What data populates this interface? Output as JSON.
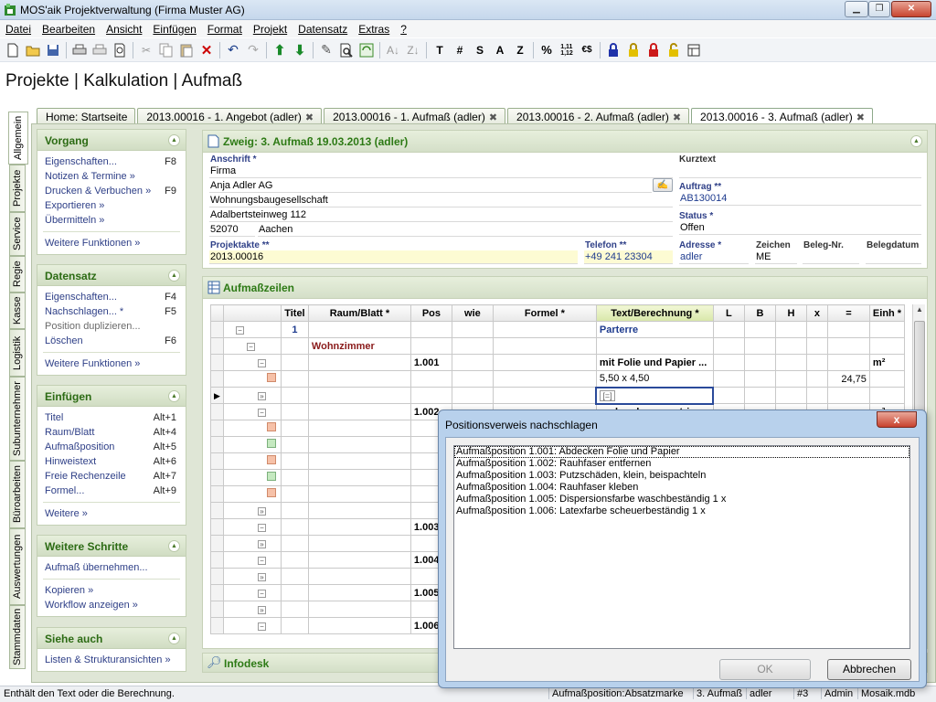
{
  "window": {
    "title": "MOS'aik Projektverwaltung (Firma Muster AG)"
  },
  "menu": [
    "Datei",
    "Bearbeiten",
    "Ansicht",
    "Einfügen",
    "Format",
    "Projekt",
    "Datensatz",
    "Extras",
    "?"
  ],
  "toolbar": {
    "text_buttons": [
      "T",
      "#",
      "S",
      "A",
      "Z",
      "%",
      "1,11\n1,12",
      "€$"
    ]
  },
  "heading": "Projekte | Kalkulation | Aufmaß",
  "tabs": [
    {
      "label": "Home: Startseite",
      "closable": false
    },
    {
      "label": "2013.00016 - 1. Angebot (adler)",
      "closable": true
    },
    {
      "label": "2013.00016 - 1. Aufmaß (adler)",
      "closable": true
    },
    {
      "label": "2013.00016 - 2. Aufmaß (adler)",
      "closable": true
    },
    {
      "label": "2013.00016 - 3. Aufmaß (adler)",
      "closable": true,
      "active": true
    }
  ],
  "vertical_tabs": [
    "Allgemein",
    "Projekte",
    "Service",
    "Regie",
    "Kasse",
    "Logistik",
    "Subunternehmer",
    "Büroarbeiten",
    "Auswertungen",
    "Stammdaten"
  ],
  "left_panel": {
    "vorgang": {
      "title": "Vorgang",
      "items": [
        {
          "label": "Eigenschaften...",
          "key": "F8"
        },
        {
          "label": "Notizen & Termine »",
          "key": ""
        },
        {
          "label": "Drucken & Verbuchen »",
          "key": "F9"
        },
        {
          "label": "Exportieren »",
          "key": ""
        },
        {
          "label": "Übermitteln »",
          "key": ""
        }
      ],
      "more": "Weitere Funktionen »"
    },
    "datensatz": {
      "title": "Datensatz",
      "items": [
        {
          "label": "Eigenschaften...",
          "key": "F4"
        },
        {
          "label": "Nachschlagen... *",
          "key": "F5"
        },
        {
          "label": "Position duplizieren...",
          "key": "",
          "disabled": true
        },
        {
          "label": "Löschen",
          "key": "F6"
        }
      ],
      "more": "Weitere Funktionen »"
    },
    "einfuegen": {
      "title": "Einfügen",
      "items": [
        {
          "label": "Titel",
          "key": "Alt+1"
        },
        {
          "label": "Raum/Blatt",
          "key": "Alt+4"
        },
        {
          "label": "Aufmaßposition",
          "key": "Alt+5"
        },
        {
          "label": "Hinweistext",
          "key": "Alt+6"
        },
        {
          "label": "Freie Rechenzeile",
          "key": "Alt+7"
        },
        {
          "label": "Formel...",
          "key": "Alt+9"
        }
      ],
      "more": "Weitere »"
    },
    "weitere_schritte": {
      "title": "Weitere Schritte",
      "items": [
        "Aufmaß übernehmen...",
        "Kopieren »",
        "Workflow anzeigen »"
      ]
    },
    "siehe_auch": {
      "title": "Siehe auch",
      "items": [
        "Listen & Strukturansichten »"
      ]
    }
  },
  "zweig": {
    "title": "Zweig: 3. Aufmaß 19.03.2013 (adler)",
    "anschrift_label": "Anschrift *",
    "anschrift": [
      "Firma",
      "Anja Adler AG",
      "Wohnungsbaugesellschaft",
      "Adalbertsteinweg 112"
    ],
    "plz": "52070",
    "ort": "Aachen",
    "kurztext_label": "Kurztext",
    "kurztext": "",
    "auftrag_label": "Auftrag **",
    "auftrag": "AB130014",
    "status_label": "Status *",
    "status": "Offen",
    "projektakte_label": "Projektakte **",
    "projektakte": "2013.00016",
    "telefon_label": "Telefon **",
    "telefon": "+49 241 23304",
    "adresse_label": "Adresse *",
    "adresse": "adler",
    "zeichen_label": "Zeichen",
    "zeichen": "ME",
    "belegnr_label": "Beleg-Nr.",
    "belegnr": "",
    "belegdatum_label": "Belegdatum",
    "belegdatum": ""
  },
  "aufmass": {
    "title": "Aufmaßzeilen",
    "columns": [
      "Titel",
      "Raum/Blatt *",
      "Pos",
      "wie",
      "Formel *",
      "Text/Berechnung *",
      "L",
      "B",
      "H",
      "x",
      "=",
      "Einh *"
    ],
    "rows": [
      {
        "titel": "1",
        "raum": "",
        "pos": "",
        "text": "Parterre",
        "eq": "",
        "einh": ""
      },
      {
        "titel": "",
        "raum": "Wohnzimmer",
        "pos": "",
        "text": "",
        "eq": "",
        "einh": ""
      },
      {
        "titel": "",
        "raum": "",
        "pos": "1.001",
        "text": "mit Folie und Papier ...",
        "eq": "",
        "einh": "m²"
      },
      {
        "titel": "",
        "raum": "",
        "pos": "",
        "text": "5,50 x 4,50",
        "eq": "24,75",
        "einh": ""
      },
      {
        "titel": "",
        "raum": "",
        "pos": "",
        "text": "",
        "eq": "",
        "einh": ""
      },
      {
        "titel": "",
        "raum": "",
        "pos": "1.002",
        "text": "vorhandene, gestric...",
        "eq": "",
        "einh": "m²"
      },
      {
        "titel": "",
        "raum": "",
        "pos": "",
        "text": "",
        "eq": "",
        "einh": ""
      },
      {
        "titel": "",
        "raum": "",
        "pos": "",
        "text": "",
        "eq": "",
        "einh": ""
      },
      {
        "titel": "",
        "raum": "",
        "pos": "",
        "text": "",
        "eq": "",
        "einh": ""
      },
      {
        "titel": "",
        "raum": "",
        "pos": "",
        "text": "",
        "eq": "",
        "einh": ""
      },
      {
        "titel": "",
        "raum": "",
        "pos": "",
        "text": "",
        "eq": "",
        "einh": ""
      },
      {
        "titel": "",
        "raum": "",
        "pos": "",
        "text": "",
        "eq": "",
        "einh": ""
      },
      {
        "titel": "",
        "raum": "",
        "pos": "1.003",
        "text": "",
        "eq": "",
        "einh": ""
      },
      {
        "titel": "",
        "raum": "",
        "pos": "",
        "text": "",
        "eq": "",
        "einh": ""
      },
      {
        "titel": "",
        "raum": "",
        "pos": "1.004",
        "text": "",
        "eq": "",
        "einh": ""
      },
      {
        "titel": "",
        "raum": "",
        "pos": "",
        "text": "",
        "eq": "",
        "einh": ""
      },
      {
        "titel": "",
        "raum": "",
        "pos": "1.005",
        "text": "",
        "eq": "",
        "einh": ""
      },
      {
        "titel": "",
        "raum": "",
        "pos": "",
        "text": "",
        "eq": "",
        "einh": ""
      },
      {
        "titel": "",
        "raum": "",
        "pos": "1.006",
        "text": "",
        "eq": "",
        "einh": ""
      }
    ],
    "active_cell": "[=]"
  },
  "infodesk": "Infodesk",
  "statusbar": {
    "hint": "Enthält den Text oder die Berechnung.",
    "cells": [
      "Aufmaßposition:Absatzmarke",
      "3. Aufmaß",
      "adler",
      "#3",
      "Admin",
      "Mosaik.mdb"
    ]
  },
  "dialog": {
    "title": "Positionsverweis nachschlagen",
    "close": "x",
    "items": [
      "Aufmaßposition 1.001: Abdecken Folie und Papier",
      "Aufmaßposition 1.002: Rauhfaser entfernen",
      "Aufmaßposition 1.003: Putzschäden, klein, beispachteln",
      "Aufmaßposition 1.004: Rauhfaser kleben",
      "Aufmaßposition 1.005: Dispersionsfarbe waschbeständig 1 x",
      "Aufmaßposition 1.006: Latexfarbe scheuerbeständig 1 x"
    ],
    "ok": "OK",
    "cancel": "Abbrechen"
  }
}
